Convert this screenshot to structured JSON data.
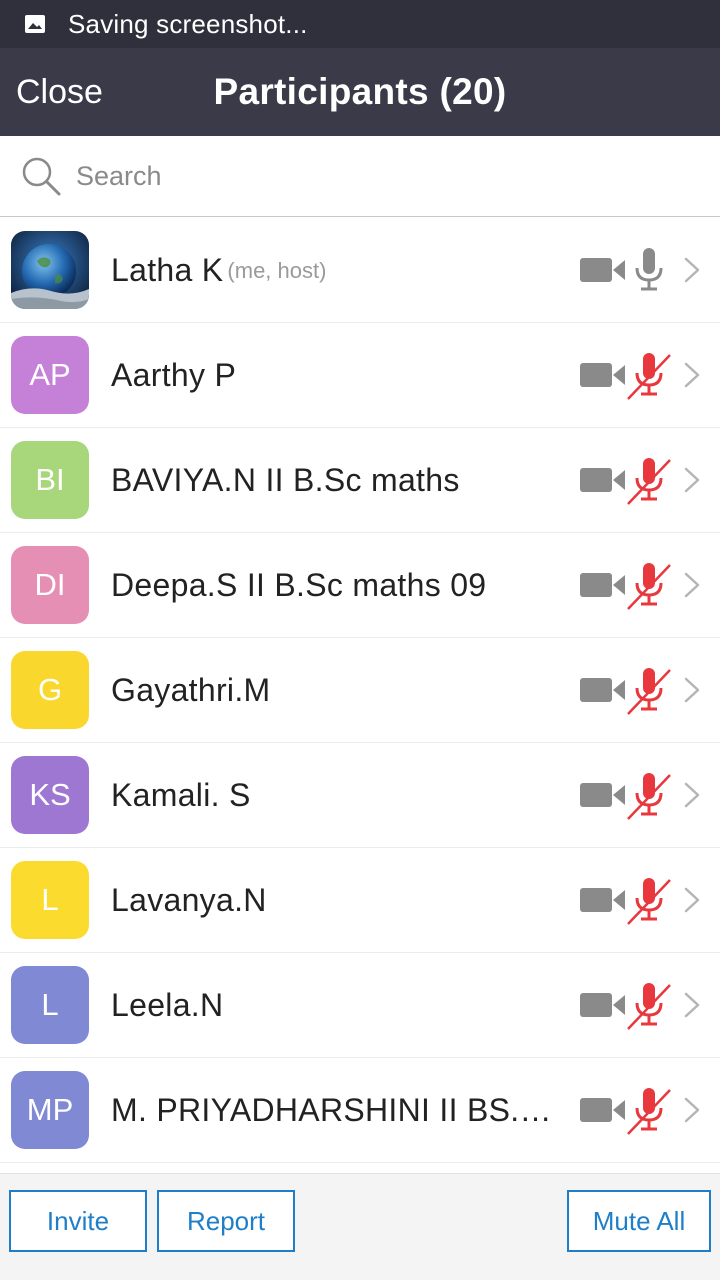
{
  "status_bar": {
    "text": "Saving screenshot..."
  },
  "header": {
    "close_label": "Close",
    "title": "Participants (20)"
  },
  "search": {
    "placeholder": "Search"
  },
  "participants": [
    {
      "name": "Latha K",
      "tag": "(me, host)",
      "avatar_type": "image",
      "initials": "",
      "color": "#2c5d8f",
      "video": "video-icon",
      "mic": "muted-false"
    },
    {
      "name": "Aarthy P",
      "tag": "",
      "avatar_type": "initials",
      "initials": "AP",
      "color": "#c580d8",
      "video": "video-icon",
      "mic": "muted-true"
    },
    {
      "name": "BAVIYA.N II B.Sc maths",
      "tag": "",
      "avatar_type": "initials",
      "initials": "BI",
      "color": "#a8d67a",
      "video": "video-icon",
      "mic": "muted-true"
    },
    {
      "name": "Deepa.S II B.Sc maths 09",
      "tag": "",
      "avatar_type": "initials",
      "initials": "DI",
      "color": "#e68fb4",
      "video": "video-icon",
      "mic": "muted-true"
    },
    {
      "name": "Gayathri.M",
      "tag": "",
      "avatar_type": "initials",
      "initials": "G",
      "color": "#f9d72c",
      "video": "video-icon",
      "mic": "muted-true"
    },
    {
      "name": "Kamali. S",
      "tag": "",
      "avatar_type": "initials",
      "initials": "KS",
      "color": "#9d77d2",
      "video": "video-icon",
      "mic": "muted-true"
    },
    {
      "name": "Lavanya.N",
      "tag": "",
      "avatar_type": "initials",
      "initials": "L",
      "color": "#fbdc2e",
      "video": "video-icon",
      "mic": "muted-true"
    },
    {
      "name": "Leela.N",
      "tag": "",
      "avatar_type": "initials",
      "initials": "L",
      "color": "#7f89d4",
      "video": "video-icon",
      "mic": "muted-true"
    },
    {
      "name": "M. PRIYADHARSHINI II BS.C...",
      "tag": "",
      "avatar_type": "initials",
      "initials": "MP",
      "color": "#7f89d4",
      "video": "video-icon",
      "mic": "muted-true"
    }
  ],
  "footer": {
    "invite_label": "Invite",
    "report_label": "Report",
    "mute_all_label": "Mute All"
  },
  "colors": {
    "accent": "#1f7ec8",
    "muted_red": "#e8383d",
    "icon_gray": "#8a8a8a",
    "header_bg": "#3a3a48"
  }
}
